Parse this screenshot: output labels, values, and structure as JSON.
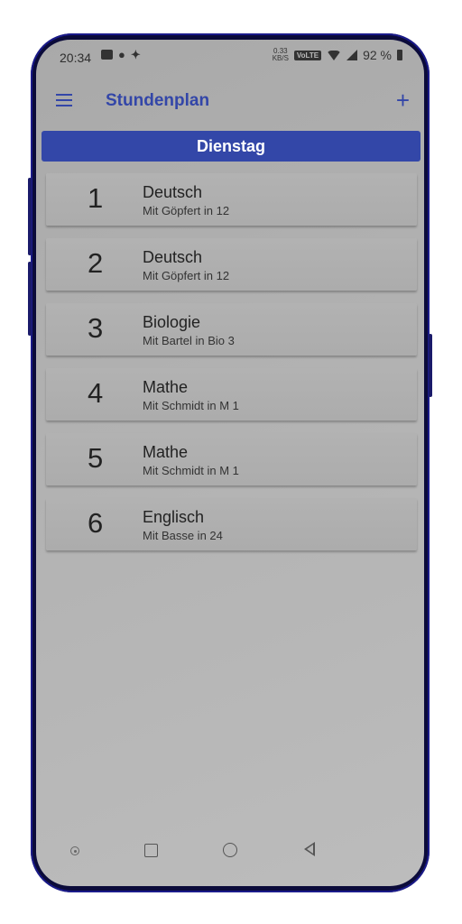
{
  "status_bar": {
    "time": "20:34",
    "net_speed_value": "0.33",
    "net_speed_unit": "KB/S",
    "volte": "VoLTE",
    "battery": "92 %"
  },
  "app_bar": {
    "title": "Stundenplan",
    "menu_icon": "menu-icon",
    "add_icon": "plus-icon",
    "add_label": "+"
  },
  "day": "Dienstag",
  "lessons": [
    {
      "number": "1",
      "subject": "Deutsch",
      "detail": "Mit Göpfert in 12"
    },
    {
      "number": "2",
      "subject": "Deutsch",
      "detail": "Mit Göpfert in 12"
    },
    {
      "number": "3",
      "subject": "Biologie",
      "detail": "Mit Bartel in Bio 3"
    },
    {
      "number": "4",
      "subject": "Mathe",
      "detail": "Mit Schmidt in M 1"
    },
    {
      "number": "5",
      "subject": "Mathe",
      "detail": "Mit Schmidt in M 1"
    },
    {
      "number": "6",
      "subject": "Englisch",
      "detail": "Mit Basse in 24"
    }
  ],
  "colors": {
    "accent": "#3347a8",
    "background": "#b0b0b0"
  }
}
